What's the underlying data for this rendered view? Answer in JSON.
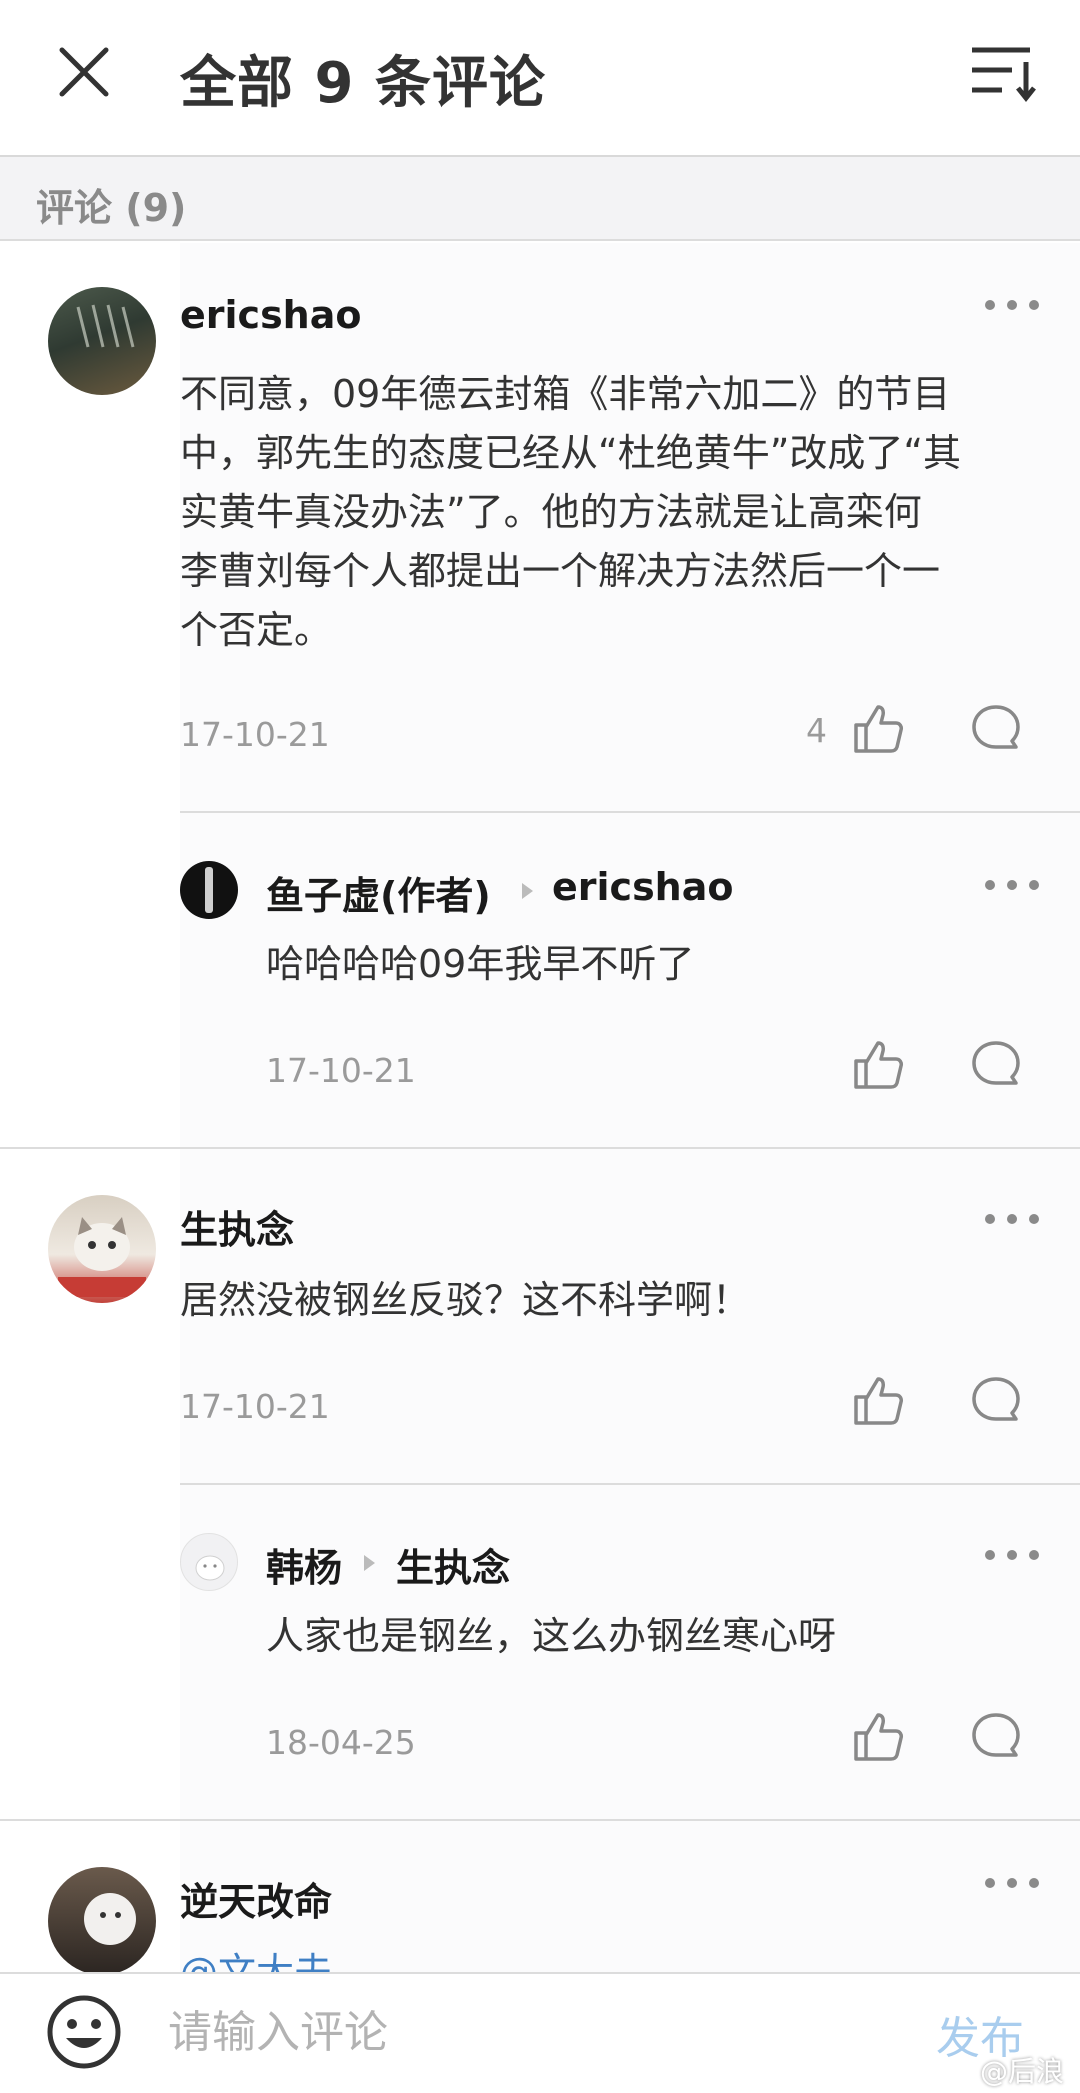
{
  "header": {
    "title": "全部 9 条评论",
    "close_icon": "close-icon",
    "sort_icon": "sort-icon"
  },
  "section": {
    "label": "评论 (9)"
  },
  "threads": [
    {
      "comment": {
        "username": "ericshao",
        "text_lines": [
          "不同意，09年德云封箱《非常六加二》的节目",
          "中，郭先生的态度已经从“杜绝黄牛”改成了“其",
          "实黄牛真没办法”了。他的方法就是让高栾何",
          "李曹刘每个人都提出一个解决方法然后一个一",
          "个否定。"
        ],
        "date": "17-10-21",
        "likes": "4"
      },
      "reply": {
        "username": "鱼子虚(作者)",
        "reply_to": "ericshao",
        "text": "哈哈哈哈09年我早不听了",
        "date": "17-10-21"
      }
    },
    {
      "comment": {
        "username": "生执念",
        "text": "居然没被钢丝反驳？这不科学啊！",
        "date": "17-10-21"
      },
      "reply": {
        "username": "韩杨",
        "reply_to": "生执念",
        "text": "人家也是钢丝，这么办钢丝寒心呀",
        "date": "18-04-25"
      }
    },
    {
      "comment": {
        "username": "逆天改命",
        "text_partial": "@文大夫"
      }
    }
  ],
  "footer": {
    "input_placeholder": "请输入评论",
    "publish_label": "发布",
    "emoji_icon": "emoji-icon",
    "watermark": "@后浪"
  },
  "colors": {
    "publish_disabled": "#a9cdee",
    "secondary_text": "#9a9a9a",
    "divider": "#dcdcdc"
  }
}
